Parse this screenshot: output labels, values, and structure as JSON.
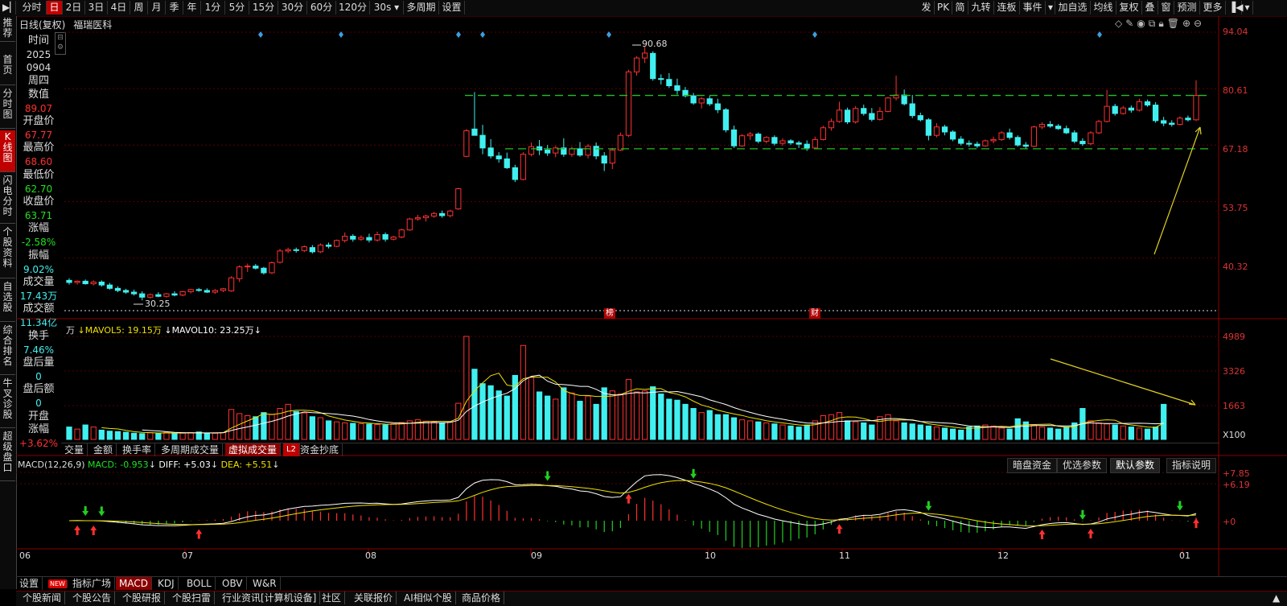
{
  "toolbar": {
    "items": [
      "分时",
      "日",
      "2日",
      "3日",
      "4日",
      "周",
      "月",
      "季",
      "年",
      "1分",
      "5分",
      "15分",
      "30分",
      "60分",
      "120分",
      "30s",
      "多周期",
      "设置"
    ],
    "selected": "日",
    "right_items": [
      "发",
      "PK",
      "简",
      "九转",
      "连板",
      "事件",
      "加自选",
      "均线",
      "复权",
      "叠",
      "窗",
      "预测",
      "更多"
    ]
  },
  "leftnav": [
    "推荐",
    "首页",
    "分时图",
    "K线图",
    "闪电分时",
    "个股资料",
    "自选股",
    "综合排名",
    "牛叉诊股",
    "超级盘口"
  ],
  "chart_header": {
    "mode": "日线(复权)",
    "stock": "福瑞医科"
  },
  "info": {
    "time_label": "时间",
    "date_year": "2025",
    "date_md": "0904",
    "weekday": "周四",
    "value_label": "数值",
    "value": "89.07",
    "open_label": "开盘价",
    "open": "67.77",
    "high_label": "最高价",
    "high": "68.60",
    "low_label": "最低价",
    "low": "62.70",
    "close_label": "收盘价",
    "close": "63.71",
    "chg_label": "涨幅",
    "chg": "-2.58%",
    "amp_label": "振幅",
    "amp": "9.02%",
    "vol_label": "成交量",
    "vol": "17.43万",
    "amt_label": "成交额",
    "amt": "11.34亿",
    "turn_label": "换手",
    "turn": "7.46%",
    "after_vol_label": "盘后量",
    "after_vol": "0",
    "after_amt_label": "盘后额",
    "after_amt": "0",
    "open_chg_label1": "开盘",
    "open_chg_label2": "涨幅",
    "open_chg": "+3.62%"
  },
  "price_axis": [
    "94.04",
    "80.61",
    "67.18",
    "53.75",
    "40.32"
  ],
  "annotations": {
    "high": "90.68",
    "low": "30.25",
    "marker1": "榜",
    "marker2": "财"
  },
  "volume_header": {
    "unit": "万",
    "mavol5": "MAVOL5: 19.15万",
    "mavol10": "MAVOL10: 23.25万"
  },
  "volume_axis": [
    "4989",
    "3326",
    "1663",
    "X100"
  ],
  "volume_tabs": [
    "交量",
    "金额",
    "换手率",
    "多周期成交量",
    "虚拟成交量",
    "L2",
    "资金抄底"
  ],
  "volume_tab_selected": "虚拟成交量",
  "macd_header": {
    "name": "MACD(12,26,9)",
    "macd": "MACD: -0.953",
    "diff": "DIFF: +5.03",
    "dea": "DEA: +5.51"
  },
  "macd_buttons": [
    "暗盘资金",
    "优选参数",
    "默认参数",
    "指标说明"
  ],
  "macd_axis": [
    "+7.85",
    "+6.19",
    "+0"
  ],
  "months": [
    "06",
    "07",
    "08",
    "09",
    "10",
    "11",
    "12",
    "01"
  ],
  "indicator_tabs": [
    "设置",
    "NEW",
    "指标广场",
    "MACD",
    "KDJ",
    "BOLL",
    "OBV",
    "W&R"
  ],
  "indicator_selected": "MACD",
  "bottom_links": [
    "个股新闻",
    "个股公告",
    "个股研报",
    "个股扫雷",
    "行业资讯[计算机设备]",
    "社区",
    "关联报价",
    "AI相似个股",
    "商品价格"
  ],
  "colors": {
    "up": "#ff3030",
    "down": "#40f0f0",
    "accent": "#c00000",
    "ma_yellow": "#f0e000",
    "ma_white": "#ffffff",
    "green_dash": "#20c020"
  },
  "chart_data": {
    "type": "candlestick",
    "ohlc": [
      [
        35.0,
        35.5,
        34.0,
        34.5
      ],
      [
        34.5,
        35.0,
        34.0,
        34.8
      ],
      [
        34.8,
        35.2,
        34.0,
        34.2
      ],
      [
        34.2,
        35.0,
        33.8,
        34.6
      ],
      [
        34.6,
        35.0,
        33.5,
        33.9
      ],
      [
        33.9,
        34.4,
        32.8,
        33.1
      ],
      [
        33.1,
        33.6,
        32.2,
        32.6
      ],
      [
        32.6,
        33.0,
        31.8,
        32.2
      ],
      [
        32.2,
        32.8,
        31.4,
        31.8
      ],
      [
        31.8,
        32.4,
        30.25,
        31.0
      ],
      [
        31.0,
        31.9,
        30.7,
        31.6
      ],
      [
        31.6,
        32.2,
        31.0,
        31.2
      ],
      [
        31.2,
        32.0,
        30.9,
        31.8
      ],
      [
        31.8,
        32.4,
        31.2,
        31.5
      ],
      [
        31.5,
        32.5,
        31.2,
        32.3
      ],
      [
        32.3,
        33.0,
        31.9,
        32.8
      ],
      [
        32.8,
        33.2,
        32.3,
        32.6
      ],
      [
        32.6,
        33.1,
        32.0,
        32.2
      ],
      [
        32.2,
        32.9,
        31.8,
        32.6
      ],
      [
        32.6,
        33.2,
        32.2,
        33.0
      ],
      [
        32.5,
        36.0,
        32.3,
        35.6
      ],
      [
        35.4,
        38.6,
        34.6,
        38.2
      ],
      [
        38.2,
        39.0,
        37.0,
        38.4
      ],
      [
        38.4,
        38.9,
        37.6,
        37.9
      ],
      [
        37.9,
        38.2,
        36.4,
        36.8
      ],
      [
        36.8,
        39.5,
        36.5,
        39.2
      ],
      [
        39.3,
        42.5,
        39.0,
        42.0
      ],
      [
        42.0,
        42.8,
        41.5,
        42.3
      ],
      [
        42.3,
        42.8,
        41.6,
        42.1
      ],
      [
        42.1,
        43.3,
        41.7,
        43.0
      ],
      [
        42.8,
        43.4,
        41.4,
        41.8
      ],
      [
        41.8,
        43.8,
        41.5,
        43.4
      ],
      [
        43.4,
        44.0,
        42.6,
        43.1
      ],
      [
        43.1,
        44.7,
        42.9,
        44.5
      ],
      [
        44.5,
        46.4,
        44.0,
        45.5
      ],
      [
        45.5,
        46.0,
        44.2,
        44.8
      ],
      [
        44.8,
        45.7,
        44.4,
        45.2
      ],
      [
        45.2,
        46.1,
        44.0,
        44.6
      ],
      [
        44.6,
        46.6,
        44.2,
        45.9
      ],
      [
        45.9,
        46.4,
        44.2,
        44.8
      ],
      [
        44.8,
        45.6,
        44.5,
        45.3
      ],
      [
        45.3,
        47.3,
        45.0,
        47.0
      ],
      [
        47.0,
        49.9,
        46.8,
        49.6
      ],
      [
        49.6,
        50.6,
        49.2,
        49.9
      ],
      [
        49.9,
        50.6,
        49.0,
        50.3
      ],
      [
        50.3,
        51.3,
        49.9,
        50.9
      ],
      [
        50.9,
        51.6,
        49.9,
        50.4
      ],
      [
        50.4,
        51.8,
        50.0,
        51.5
      ],
      [
        52.0,
        57.0,
        51.8,
        56.8
      ],
      [
        64.5,
        71.0,
        64.3,
        70.6
      ],
      [
        71.0,
        79.8,
        70.3,
        69.5
      ],
      [
        69.5,
        72.0,
        65.0,
        66.5
      ],
      [
        66.5,
        68.6,
        64.0,
        64.6
      ],
      [
        64.6,
        65.5,
        63.0,
        63.9
      ],
      [
        63.9,
        65.4,
        61.5,
        61.8
      ],
      [
        61.8,
        62.5,
        58.4,
        59.0
      ],
      [
        59.0,
        65.5,
        58.8,
        65.0
      ],
      [
        65.0,
        67.8,
        64.5,
        66.8
      ],
      [
        66.8,
        68.4,
        64.8,
        66.0
      ],
      [
        66.0,
        67.2,
        64.6,
        65.3
      ],
      [
        65.3,
        67.0,
        64.3,
        66.5
      ],
      [
        66.5,
        68.8,
        64.4,
        65.0
      ],
      [
        65.0,
        66.8,
        64.4,
        66.3
      ],
      [
        66.3,
        67.9,
        64.4,
        64.8
      ],
      [
        64.8,
        67.4,
        64.0,
        66.9
      ],
      [
        66.9,
        67.8,
        63.8,
        64.6
      ],
      [
        64.6,
        65.5,
        61.0,
        62.9
      ],
      [
        62.9,
        66.5,
        61.5,
        66.0
      ],
      [
        66.0,
        70.2,
        65.8,
        69.5
      ],
      [
        69.5,
        85.1,
        69.1,
        84.6
      ],
      [
        84.6,
        88.3,
        83.7,
        87.9
      ],
      [
        87.9,
        90.68,
        86.7,
        89.07
      ],
      [
        89.0,
        89.5,
        82.5,
        83.0
      ],
      [
        83.0,
        84.0,
        81.6,
        82.8
      ],
      [
        82.8,
        84.3,
        80.8,
        81.3
      ],
      [
        81.3,
        83.0,
        79.2,
        80.2
      ],
      [
        80.2,
        81.0,
        78.5,
        78.9
      ],
      [
        78.9,
        79.6,
        76.8,
        77.2
      ],
      [
        77.2,
        78.6,
        75.9,
        78.2
      ],
      [
        78.2,
        78.9,
        76.5,
        77.0
      ],
      [
        77.0,
        78.2,
        74.8,
        75.6
      ],
      [
        75.6,
        76.0,
        70.2,
        70.8
      ],
      [
        70.8,
        71.8,
        66.5,
        67.0
      ],
      [
        67.0,
        69.8,
        66.8,
        69.4
      ],
      [
        69.4,
        70.3,
        68.4,
        69.8
      ],
      [
        69.8,
        70.2,
        67.6,
        68.1
      ],
      [
        68.1,
        69.3,
        67.6,
        69.0
      ],
      [
        69.0,
        69.5,
        67.1,
        67.6
      ],
      [
        67.6,
        68.8,
        67.0,
        68.2
      ],
      [
        68.2,
        68.6,
        67.2,
        67.7
      ],
      [
        67.7,
        68.2,
        66.5,
        67.4
      ],
      [
        67.4,
        68.3,
        65.8,
        66.5
      ],
      [
        66.5,
        69.2,
        66.3,
        68.5
      ],
      [
        68.5,
        71.8,
        68.3,
        71.3
      ],
      [
        71.3,
        73.5,
        70.6,
        72.8
      ],
      [
        72.8,
        77.5,
        72.5,
        75.5
      ],
      [
        75.5,
        76.1,
        72.2,
        72.7
      ],
      [
        72.7,
        76.5,
        72.3,
        75.9
      ],
      [
        75.9,
        76.8,
        74.2,
        74.7
      ],
      [
        74.7,
        76.0,
        72.8,
        73.3
      ],
      [
        73.3,
        76.2,
        73.0,
        75.2
      ],
      [
        75.2,
        78.6,
        75.0,
        78.4
      ],
      [
        78.4,
        83.7,
        77.8,
        79.1
      ],
      [
        79.1,
        80.4,
        76.6,
        77.0
      ],
      [
        77.0,
        79.1,
        73.6,
        74.2
      ],
      [
        74.2,
        74.9,
        72.8,
        73.2
      ],
      [
        73.2,
        73.6,
        68.3,
        69.5
      ],
      [
        69.5,
        72.4,
        69.0,
        71.5
      ],
      [
        71.5,
        72.0,
        69.5,
        70.3
      ],
      [
        70.3,
        70.7,
        68.1,
        68.6
      ],
      [
        68.6,
        69.3,
        67.1,
        67.6
      ],
      [
        67.6,
        68.3,
        66.8,
        67.4
      ],
      [
        67.4,
        68.0,
        66.5,
        67.0
      ],
      [
        67.0,
        68.5,
        66.8,
        68.2
      ],
      [
        68.2,
        69.2,
        67.6,
        68.5
      ],
      [
        68.5,
        70.5,
        68.2,
        70.1
      ],
      [
        70.1,
        71.1,
        68.5,
        69.0
      ],
      [
        69.0,
        69.5,
        66.8,
        67.2
      ],
      [
        67.2,
        67.9,
        66.3,
        66.9
      ],
      [
        66.9,
        71.8,
        66.7,
        71.5
      ],
      [
        71.5,
        72.6,
        71.0,
        72.1
      ],
      [
        72.1,
        72.9,
        71.3,
        71.7
      ],
      [
        71.7,
        72.2,
        70.8,
        71.1
      ],
      [
        71.1,
        71.8,
        69.8,
        70.1
      ],
      [
        70.1,
        70.7,
        67.6,
        68.1
      ],
      [
        68.1,
        68.8,
        67.0,
        67.5
      ],
      [
        67.5,
        70.5,
        67.2,
        70.1
      ],
      [
        70.1,
        73.2,
        69.8,
        72.8
      ],
      [
        72.8,
        80.3,
        72.6,
        76.4
      ],
      [
        76.4,
        77.0,
        74.2,
        74.7
      ],
      [
        74.7,
        76.5,
        74.4,
        76.0
      ],
      [
        76.0,
        76.6,
        74.9,
        75.5
      ],
      [
        75.5,
        78.2,
        75.2,
        77.5
      ],
      [
        77.5,
        78.0,
        76.3,
        76.7
      ],
      [
        76.7,
        77.4,
        72.5,
        73.0
      ],
      [
        73.0,
        73.9,
        71.7,
        72.4
      ],
      [
        72.4,
        73.1,
        71.6,
        72.1
      ],
      [
        72.1,
        74.0,
        71.9,
        73.6
      ],
      [
        73.6,
        74.2,
        72.8,
        73.2
      ],
      [
        73.2,
        82.6,
        72.9,
        79.0
      ]
    ],
    "volume_x100": [
      600,
      500,
      700,
      600,
      450,
      400,
      380,
      350,
      300,
      280,
      320,
      300,
      350,
      280,
      300,
      330,
      360,
      310,
      300,
      330,
      1450,
      1250,
      1150,
      1100,
      1300,
      1220,
      1500,
      1700,
      1350,
      1280,
      1100,
      1050,
      900,
      850,
      800,
      780,
      760,
      740,
      720,
      700,
      760,
      820,
      900,
      950,
      880,
      840,
      800,
      860,
      1750,
      4989,
      3400,
      2700,
      2600,
      2350,
      2100,
      3100,
      4550,
      3000,
      2300,
      2100,
      1950,
      2500,
      2250,
      1850,
      2100,
      1700,
      2500,
      2350,
      2200,
      2900,
      2300,
      2350,
      2550,
      2200,
      1950,
      1900,
      1700,
      1500,
      1300,
      1400,
      1200,
      1200,
      1050,
      950,
      900,
      850,
      800,
      750,
      700,
      650,
      600,
      700,
      900,
      1150,
      1200,
      1300,
      900,
      850,
      800,
      700,
      1100,
      1200,
      900,
      800,
      750,
      700,
      650,
      600,
      550,
      500,
      450,
      600,
      650,
      700,
      650,
      550,
      500,
      1000,
      850,
      700,
      600,
      550,
      500,
      600,
      800,
      1500,
      900,
      800,
      750,
      700,
      650,
      600,
      550,
      500,
      600,
      1700
    ],
    "dashed_levels": [
      79.0,
      66.3
    ],
    "macd_ylim": [
      -8,
      7.85
    ]
  }
}
